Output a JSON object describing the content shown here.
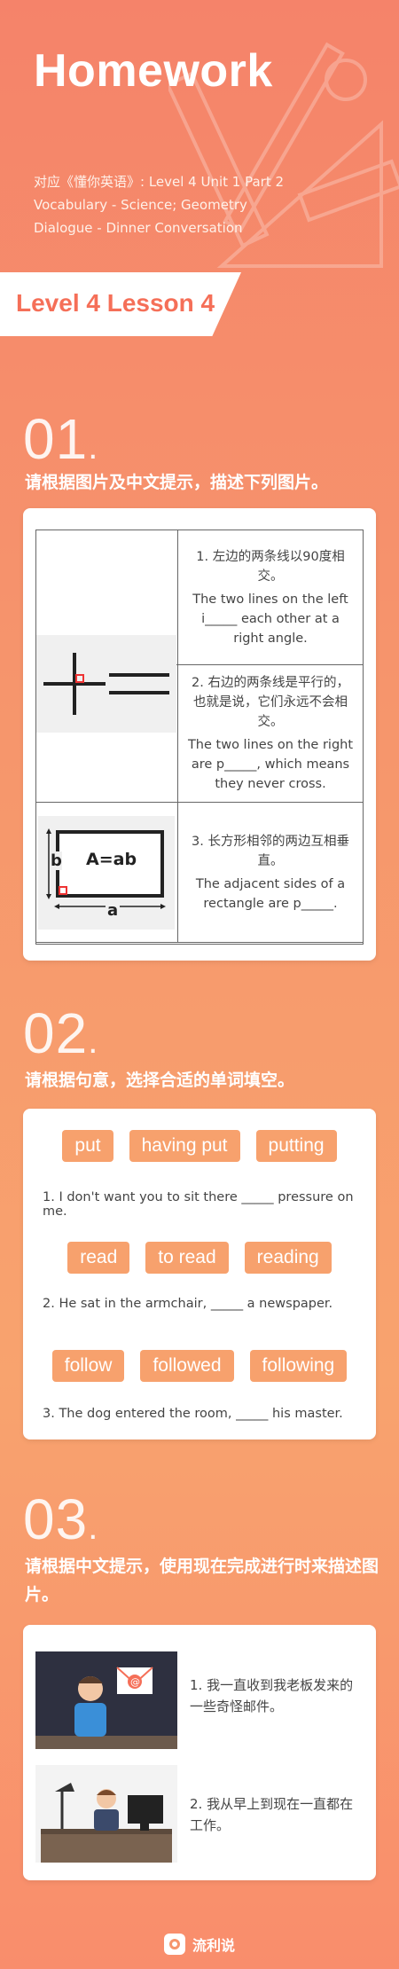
{
  "header": {
    "title": "Homework",
    "meta": [
      "对应《懂你英语》: Level 4 Unit 1 Part 2",
      "Vocabulary - Science; Geometry",
      "Dialogue - Dinner Conversation"
    ],
    "level": "Level 4 Lesson 4"
  },
  "s1": {
    "num": "01",
    "instruction": "请根据图片及中文提示，描述下列图片。",
    "rows": [
      {
        "cn": "1. 左边的两条线以90度相交。",
        "en": "The two lines on the left i_____ each other at a right angle."
      },
      {
        "cn": "2. 右边的两条线是平行的，也就是说，它们永远不会相交。",
        "en": "The two lines on the right are p_____, which means they never cross."
      },
      {
        "cn": "3. 长方形相邻的两边互相垂直。",
        "en": "The adjacent sides of a rectangle are p_____."
      }
    ],
    "diagram": {
      "area": "A=ab",
      "a": "a",
      "b": "b"
    }
  },
  "s2": {
    "num": "02",
    "instruction": "请根据句意，选择合适的单词填空。",
    "groups": [
      {
        "options": [
          "put",
          "having put",
          "putting"
        ],
        "sentence": "1. I don't want you to sit there _____ pressure on me."
      },
      {
        "options": [
          "read",
          "to read",
          "reading"
        ],
        "sentence": "2. He sat in the armchair, _____ a newspaper."
      },
      {
        "options": [
          "follow",
          "followed",
          "following"
        ],
        "sentence": "3. The dog entered the room, _____ his master."
      }
    ]
  },
  "s3": {
    "num": "03",
    "instruction": "请根据中文提示，使用现在完成进行时来描述图片。",
    "items": [
      {
        "text": "1.   我一直收到我老板发来的一些奇怪邮件。"
      },
      {
        "text": "2.  我从早上到现在一直都在工作。"
      }
    ]
  },
  "footer": {
    "brand": "流利说"
  },
  "colors": {
    "accent": "#f56f58",
    "chip": "#f7a16d"
  }
}
